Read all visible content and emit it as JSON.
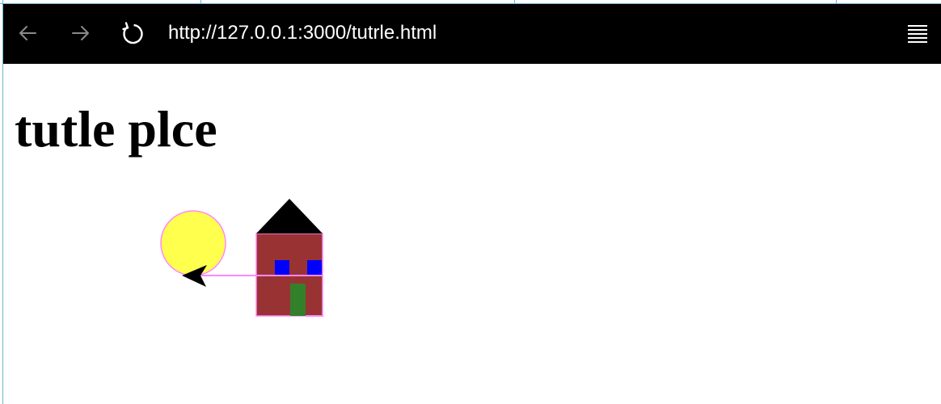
{
  "browser": {
    "url": "http://127.0.0.1:3000/tutrle.html",
    "back_icon": "arrow-left-icon",
    "forward_icon": "arrow-right-icon",
    "reload_icon": "reload-icon",
    "menu_icon": "hamburger-menu-icon"
  },
  "page": {
    "heading": "tutle plce"
  },
  "drawing": {
    "sun_color": "#ffff4d",
    "outline_color": "#ff88ff",
    "house_color": "#993333",
    "roof_color": "#000000",
    "window_color": "#0000ff",
    "door_color": "#33802b",
    "turtle_color": "#000000"
  }
}
